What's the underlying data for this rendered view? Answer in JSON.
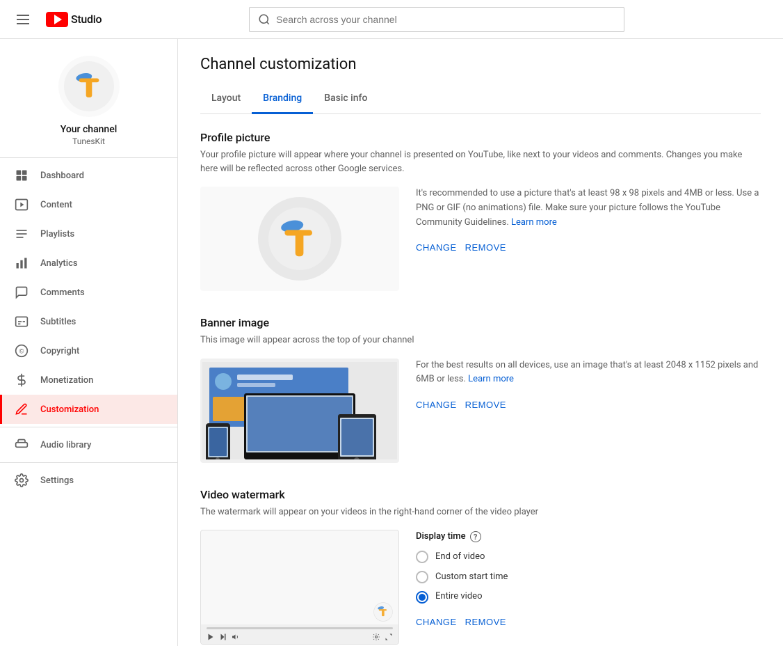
{
  "header": {
    "menu_icon": "hamburger-icon",
    "logo_text": "Studio",
    "search_placeholder": "Search across your channel"
  },
  "sidebar": {
    "channel_name": "Your channel",
    "channel_handle": "TunesKit",
    "items": [
      {
        "id": "dashboard",
        "label": "Dashboard",
        "icon": "dashboard-icon"
      },
      {
        "id": "content",
        "label": "Content",
        "icon": "content-icon"
      },
      {
        "id": "playlists",
        "label": "Playlists",
        "icon": "playlists-icon"
      },
      {
        "id": "analytics",
        "label": "Analytics",
        "icon": "analytics-icon"
      },
      {
        "id": "comments",
        "label": "Comments",
        "icon": "comments-icon"
      },
      {
        "id": "subtitles",
        "label": "Subtitles",
        "icon": "subtitles-icon"
      },
      {
        "id": "copyright",
        "label": "Copyright",
        "icon": "copyright-icon"
      },
      {
        "id": "monetization",
        "label": "Monetization",
        "icon": "monetization-icon"
      },
      {
        "id": "customization",
        "label": "Customization",
        "icon": "customization-icon",
        "active": true
      }
    ],
    "bottom_items": [
      {
        "id": "audio-library",
        "label": "Audio library",
        "icon": "audio-library-icon"
      },
      {
        "id": "settings",
        "label": "Settings",
        "icon": "settings-icon"
      }
    ]
  },
  "page": {
    "title": "Channel customization",
    "tabs": [
      {
        "id": "layout",
        "label": "Layout",
        "active": false
      },
      {
        "id": "branding",
        "label": "Branding",
        "active": true
      },
      {
        "id": "basic-info",
        "label": "Basic info",
        "active": false
      }
    ]
  },
  "sections": {
    "profile_picture": {
      "title": "Profile picture",
      "description": "Your profile picture will appear where your channel is presented on YouTube, like next to your videos and comments. Changes you make here will be reflected across other Google services.",
      "info_text": "It's recommended to use a picture that's at least 98 x 98 pixels and 4MB or less. Use a PNG or GIF (no animations) file. Make sure your picture follows the YouTube Community Guidelines.",
      "learn_more_label": "Learn more",
      "change_label": "CHANGE",
      "remove_label": "REMOVE"
    },
    "banner_image": {
      "title": "Banner image",
      "description": "This image will appear across the top of your channel",
      "info_text": "For the best results on all devices, use an image that's at least 2048 x 1152 pixels and 6MB or less.",
      "learn_more_label": "Learn more",
      "change_label": "CHANGE",
      "remove_label": "REMOVE"
    },
    "video_watermark": {
      "title": "Video watermark",
      "description": "The watermark will appear on your videos in the right-hand corner of the video player",
      "display_time_label": "Display time",
      "radio_options": [
        {
          "id": "end-of-video",
          "label": "End of video",
          "checked": false
        },
        {
          "id": "custom-start-time",
          "label": "Custom start time",
          "checked": false
        },
        {
          "id": "entire-video",
          "label": "Entire video",
          "checked": true
        }
      ],
      "change_label": "CHANGE",
      "remove_label": "REMOVE"
    }
  }
}
